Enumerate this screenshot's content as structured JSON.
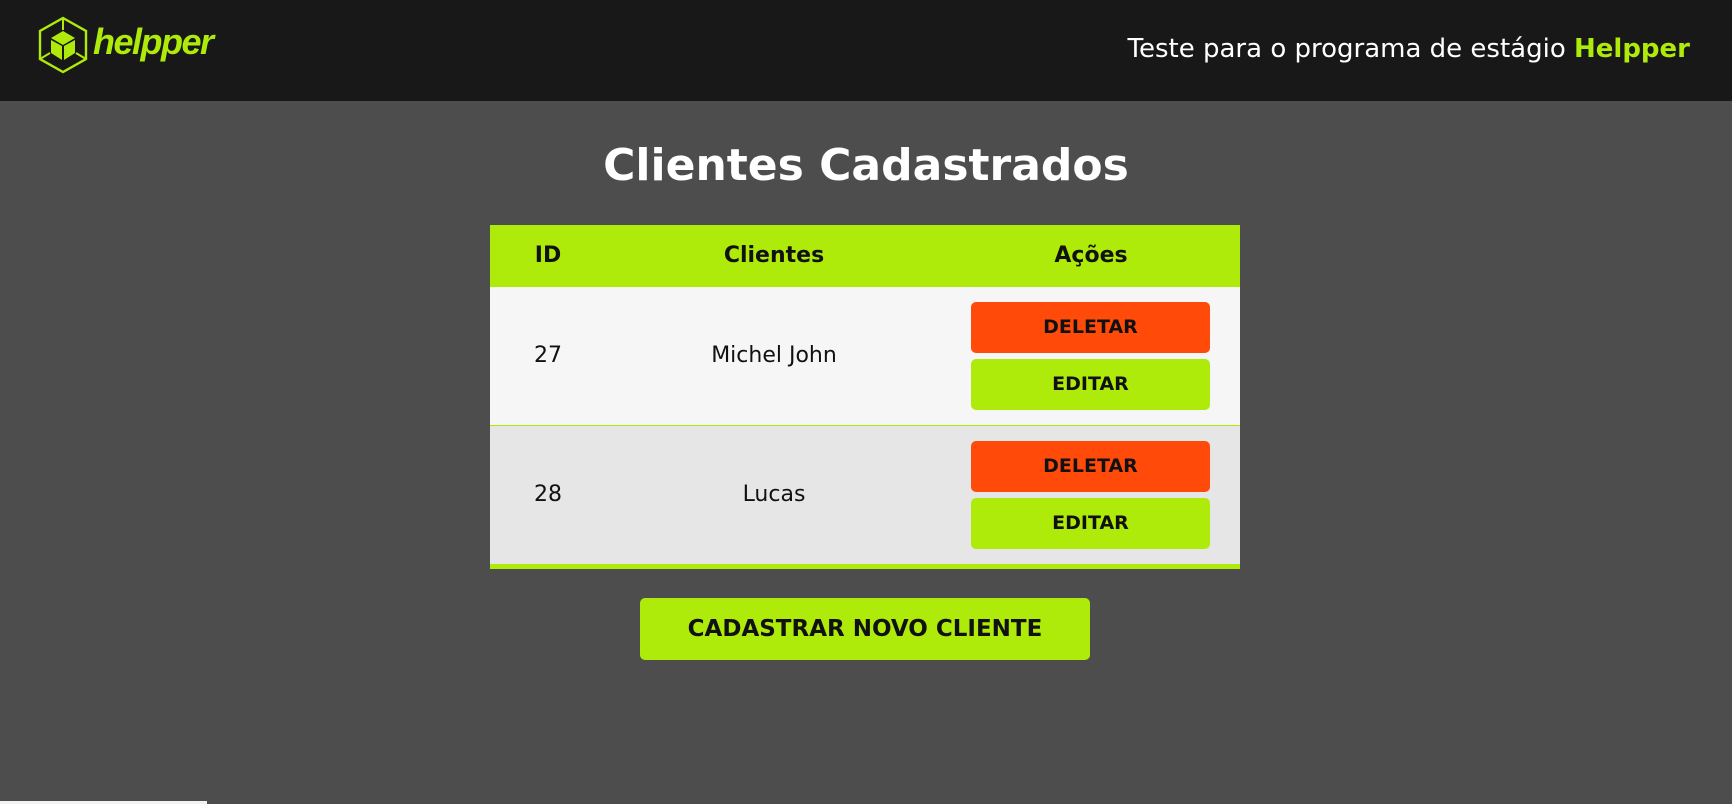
{
  "header": {
    "logo_text": "helpper",
    "tagline_prefix": "Teste para o programa de estágio",
    "tagline_brand": "Helpper"
  },
  "main": {
    "title": "Clientes Cadastrados",
    "table": {
      "columns": [
        "ID",
        "Clientes",
        "Ações"
      ],
      "rows": [
        {
          "id": "27",
          "name": "Michel John",
          "delete_label": "DELETAR",
          "edit_label": "EDITAR"
        },
        {
          "id": "28",
          "name": "Lucas",
          "delete_label": "DELETAR",
          "edit_label": "EDITAR"
        }
      ]
    },
    "new_client_label": "CADASTRAR NOVO CLIENTE"
  },
  "colors": {
    "accent": "#aeea0a",
    "danger": "#ff4a0a",
    "topbar": "#181818",
    "background": "#4d4d4d"
  }
}
